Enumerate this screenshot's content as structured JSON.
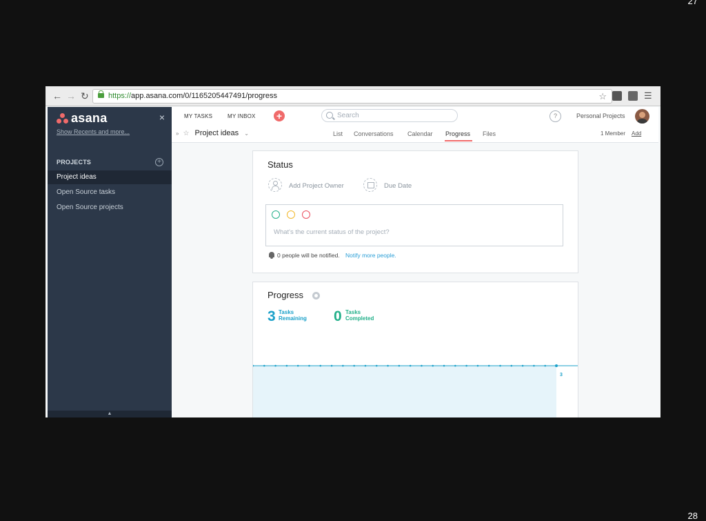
{
  "slide": {
    "number_top": "27",
    "number_bottom": "28"
  },
  "browser": {
    "url_scheme": "https://",
    "url_rest": "app.asana.com/0/1165205447491/progress",
    "back_icon": "back-arrow-icon",
    "forward_icon": "forward-arrow-icon",
    "reload_icon": "reload-icon"
  },
  "sidebar": {
    "logo_text": "asana",
    "close_symbol": "×",
    "show_recents": "Show Recents and more...",
    "projects_heading": "PROJECTS",
    "add_symbol": "+",
    "projects": [
      {
        "label": "Project ideas",
        "active": true
      },
      {
        "label": "Open Source tasks",
        "active": false
      },
      {
        "label": "Open Source projects",
        "active": false
      }
    ],
    "footer_symbol": "▲"
  },
  "topbar": {
    "my_tasks": "MY TASKS",
    "my_inbox": "MY INBOX",
    "plus_symbol": "+",
    "search_placeholder": "Search",
    "help_symbol": "?",
    "personal_projects": "Personal Projects"
  },
  "project_header": {
    "title": "Project ideas",
    "chevron": "⌄",
    "collapse_symbol": "»",
    "star_symbol": "☆",
    "tabs": [
      {
        "label": "List"
      },
      {
        "label": "Conversations"
      },
      {
        "label": "Calendar"
      },
      {
        "label": "Progress",
        "active": true
      },
      {
        "label": "Files"
      }
    ],
    "member_count": "1 Member",
    "add_label": "Add"
  },
  "status_card": {
    "title": "Status",
    "add_owner": "Add Project Owner",
    "due_date": "Due Date",
    "status_colors": [
      "#23b08a",
      "#f2b829",
      "#ea4e5e"
    ],
    "status_placeholder": "What's the current status of the project?",
    "notify_text": "0 people will be notified.",
    "notify_link": "Notify more people."
  },
  "progress_card": {
    "title": "Progress",
    "remaining_count": "3",
    "remaining_label_1": "Tasks",
    "remaining_label_2": "Remaining",
    "completed_count": "0",
    "completed_label_1": "Tasks",
    "completed_label_2": "Completed",
    "chart_end_label": "3"
  },
  "chart_data": {
    "type": "area",
    "series": [
      {
        "values": [
          3,
          3,
          3,
          3,
          3,
          3,
          3,
          3,
          3,
          3,
          3,
          3,
          3,
          3,
          3,
          3,
          3,
          3,
          3,
          3,
          3,
          3,
          3,
          3,
          3,
          3,
          3,
          3
        ]
      }
    ],
    "ylim": [
      0,
      3
    ],
    "accent": "#1aa0c9",
    "fill": "#e6f4fa"
  }
}
